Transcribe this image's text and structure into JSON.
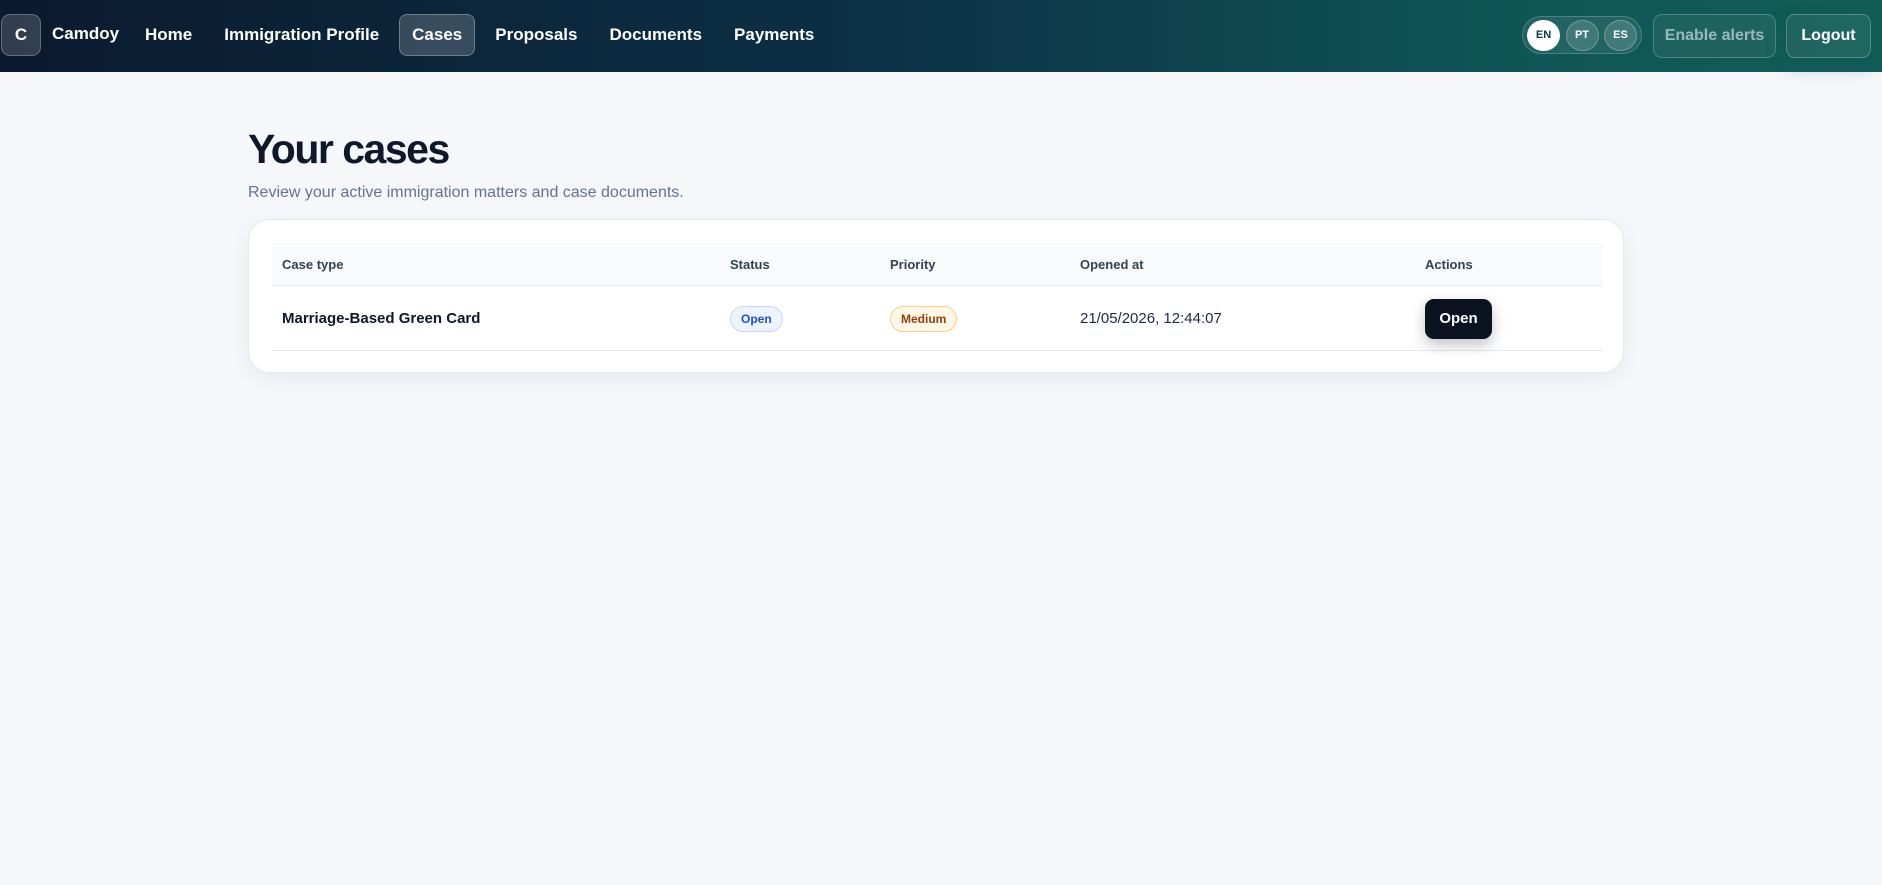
{
  "brand": {
    "mark": "C",
    "name": "Camdoy"
  },
  "nav": {
    "items": [
      {
        "label": "Home"
      },
      {
        "label": "Immigration Profile"
      },
      {
        "label": "Cases",
        "active": true
      },
      {
        "label": "Proposals"
      },
      {
        "label": "Documents"
      },
      {
        "label": "Payments"
      }
    ]
  },
  "languages": {
    "options": [
      {
        "code": "EN",
        "active": true
      },
      {
        "code": "PT"
      },
      {
        "code": "ES"
      }
    ]
  },
  "header_actions": {
    "alerts_label": "Enable alerts",
    "logout_label": "Logout"
  },
  "page": {
    "title": "Your cases",
    "subtitle": "Review your active immigration matters and case documents."
  },
  "cases_table": {
    "columns": [
      "Case type",
      "Status",
      "Priority",
      "Opened at",
      "Actions"
    ],
    "rows": [
      {
        "case_type": "Marriage-Based Green Card",
        "status": "Open",
        "priority": "Medium",
        "opened_at": "21/05/2026, 12:44:07",
        "action_label": "Open"
      }
    ]
  },
  "colors": {
    "nav_gradient_start": "#0b1a2e",
    "nav_gradient_end": "#125d58",
    "page_background": "#f5f7fa",
    "status_open": "#1d4ed8",
    "priority_medium": "#92400e",
    "primary_button": "#0b1220"
  }
}
